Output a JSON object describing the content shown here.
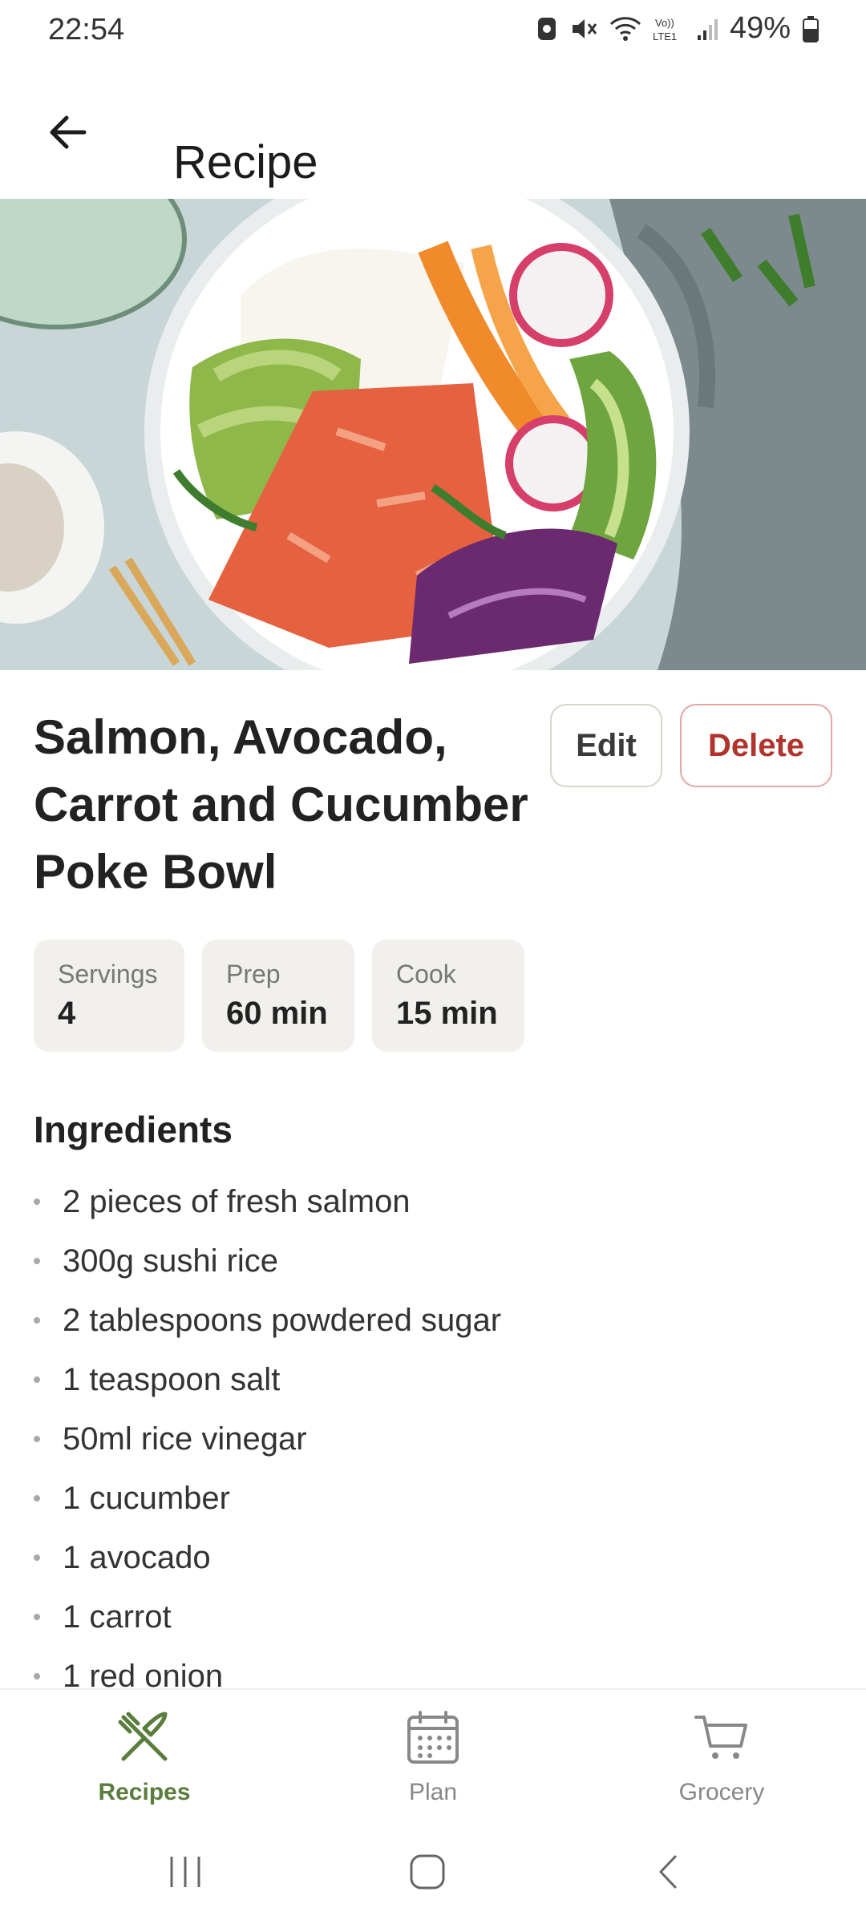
{
  "status_bar": {
    "time": "22:54",
    "network_label": "Vo)) LTE1",
    "battery": "49%"
  },
  "app_bar": {
    "title": "Recipe"
  },
  "recipe": {
    "title": "Salmon, Avocado, Carrot and Cucumber Poke Bowl",
    "actions": {
      "edit": "Edit",
      "delete": "Delete"
    },
    "stats": [
      {
        "label": "Servings",
        "value": "4"
      },
      {
        "label": "Prep",
        "value": "60 min"
      },
      {
        "label": "Cook",
        "value": "15 min"
      }
    ],
    "ingredients_title": "Ingredients",
    "ingredients": [
      "2 pieces of fresh salmon",
      "300g sushi rice",
      "2 tablespoons powdered sugar",
      "1 teaspoon salt",
      "50ml rice vinegar",
      "1 cucumber",
      "1 avocado",
      "1 carrot",
      "1 red onion"
    ]
  },
  "bottom_nav": {
    "items": [
      {
        "label": "Recipes",
        "icon": "fork-knife-icon",
        "active": true
      },
      {
        "label": "Plan",
        "icon": "calendar-icon",
        "active": false
      },
      {
        "label": "Grocery",
        "icon": "cart-icon",
        "active": false
      }
    ]
  },
  "colors": {
    "accent": "#5a7d3c",
    "delete": "#b0332c",
    "chip_bg": "#f1f0ec"
  }
}
